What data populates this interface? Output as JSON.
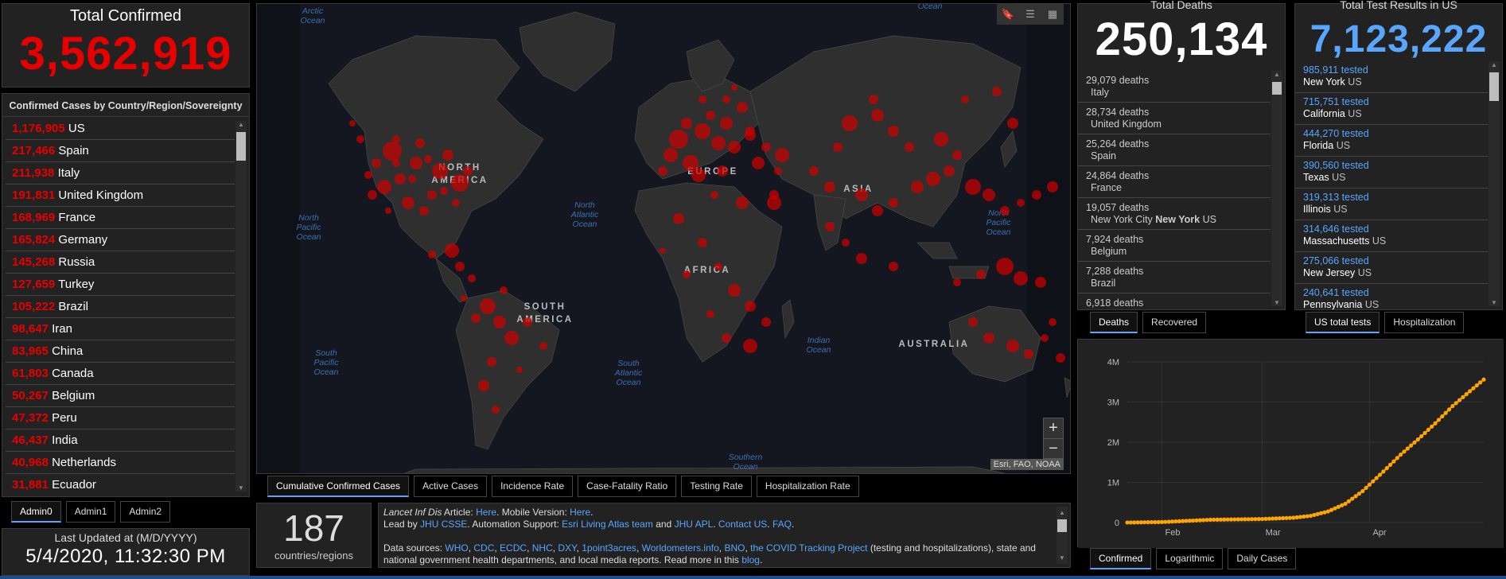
{
  "total_confirmed": {
    "title": "Total Confirmed",
    "value": "3,562,919"
  },
  "country_list": {
    "header": "Confirmed Cases by Country/Region/Sovereignty",
    "rows": [
      {
        "value": "1,176,905",
        "name": "US"
      },
      {
        "value": "217,466",
        "name": "Spain"
      },
      {
        "value": "211,938",
        "name": "Italy"
      },
      {
        "value": "191,831",
        "name": "United Kingdom"
      },
      {
        "value": "168,969",
        "name": "France"
      },
      {
        "value": "165,824",
        "name": "Germany"
      },
      {
        "value": "145,268",
        "name": "Russia"
      },
      {
        "value": "127,659",
        "name": "Turkey"
      },
      {
        "value": "105,222",
        "name": "Brazil"
      },
      {
        "value": "98,647",
        "name": "Iran"
      },
      {
        "value": "83,965",
        "name": "China"
      },
      {
        "value": "61,803",
        "name": "Canada"
      },
      {
        "value": "50,267",
        "name": "Belgium"
      },
      {
        "value": "47,372",
        "name": "Peru"
      },
      {
        "value": "46,437",
        "name": "India"
      },
      {
        "value": "40,968",
        "name": "Netherlands"
      },
      {
        "value": "31,881",
        "name": "Ecuador"
      }
    ]
  },
  "admin_tabs": [
    "Admin0",
    "Admin1",
    "Admin2"
  ],
  "last_updated": {
    "title": "Last Updated at (M/D/YYYY)",
    "value": "5/4/2020, 11:32:30 PM"
  },
  "map": {
    "oceans": [
      "Arctic Ocean",
      "North Pacific Ocean",
      "North Atlantic Ocean",
      "South Pacific Ocean",
      "South Atlantic Ocean",
      "Indian Ocean",
      "Southern Ocean",
      "North Pacific Ocean",
      "Ocean"
    ],
    "continents": [
      "NORTH AMERICA",
      "EUROPE",
      "ASIA",
      "AFRICA",
      "SOUTH AMERICA",
      "AUSTRALIA"
    ],
    "attribution": "Esri, FAO, NOAA",
    "zoom_in": "+",
    "zoom_out": "−",
    "tool_icons": [
      "bookmark-icon",
      "legend-icon",
      "qr-code-icon"
    ],
    "marker_color": "#cc0000"
  },
  "map_tabs": [
    "Cumulative Confirmed Cases",
    "Active Cases",
    "Incidence Rate",
    "Case-Fatality Ratio",
    "Testing Rate",
    "Hospitalization Rate"
  ],
  "countries_count": {
    "value": "187",
    "label": "countries/regions"
  },
  "info": {
    "line1_pre": "Lancet Inf Dis",
    "line1_article": " Article: ",
    "here1": "Here",
    "mobile": ". Mobile Version: ",
    "here2": "Here",
    "dot": ".",
    "led_by": "Lead by ",
    "jhu_csse": "JHU CSSE",
    "automation": ". Automation Support: ",
    "esri_team": "Esri Living Atlas team",
    "and": " and ",
    "jhu_apl": "JHU APL",
    "dot2": ". ",
    "contact": "Contact US",
    "dot3": ". ",
    "faq": "FAQ",
    "dot4": ".",
    "sources_label": "Data sources: ",
    "sources": [
      "WHO",
      "CDC",
      "ECDC",
      "NHC",
      "DXY",
      "1point3acres",
      "Worldometers.info",
      "BNO",
      "the COVID Tracking Project"
    ],
    "sources_suffix": " (testing and hospitalizations), state and national government health departments, and local media reports.  Read more in this ",
    "blog": "blog",
    "end": "."
  },
  "deaths": {
    "title": "Total Deaths",
    "value": "250,134",
    "rows": [
      {
        "count": "29,079 deaths",
        "place": "Italy",
        "bold": ""
      },
      {
        "count": "28,734 deaths",
        "place": "United Kingdom",
        "bold": ""
      },
      {
        "count": "25,264 deaths",
        "place": "Spain",
        "bold": ""
      },
      {
        "count": "24,864 deaths",
        "place": "France",
        "bold": ""
      },
      {
        "count": "19,057 deaths",
        "place": "New York City ",
        "bold": "New York",
        "suffix": " US"
      },
      {
        "count": "7,924 deaths",
        "place": "Belgium",
        "bold": ""
      },
      {
        "count": "7,288 deaths",
        "place": "Brazil",
        "bold": ""
      },
      {
        "count": "6,918 deaths",
        "place": "Germany",
        "bold": ""
      }
    ],
    "tabs": [
      "Deaths",
      "Recovered"
    ]
  },
  "tests": {
    "title": "Total Test Results in US",
    "value": "7,123,222",
    "rows": [
      {
        "count": "985,911 tested",
        "state": "New York",
        "country": " US"
      },
      {
        "count": "715,751 tested",
        "state": "California",
        "country": " US"
      },
      {
        "count": "444,270 tested",
        "state": "Florida",
        "country": " US"
      },
      {
        "count": "390,560 tested",
        "state": "Texas",
        "country": " US"
      },
      {
        "count": "319,313 tested",
        "state": "Illinois",
        "country": " US"
      },
      {
        "count": "314,646 tested",
        "state": "Massachusetts",
        "country": " US"
      },
      {
        "count": "275,066 tested",
        "state": "New Jersey",
        "country": " US"
      },
      {
        "count": "240,641 tested",
        "state": "Pennsylvania",
        "country": " US"
      }
    ],
    "tabs": [
      "US total tests",
      "Hospitalization"
    ]
  },
  "chart_tabs": [
    "Confirmed",
    "Logarithmic",
    "Daily Cases"
  ],
  "chart_data": {
    "type": "line",
    "y_tick_labels": [
      "0",
      "1M",
      "2M",
      "3M",
      "4M"
    ],
    "x_tick_labels": [
      "Feb",
      "Mar",
      "Apr"
    ],
    "ylim": [
      0,
      4000000
    ],
    "x": [
      "2020-01-22",
      "2020-02-01",
      "2020-02-15",
      "2020-03-01",
      "2020-03-10",
      "2020-03-15",
      "2020-03-20",
      "2020-03-25",
      "2020-03-30",
      "2020-04-05",
      "2020-04-10",
      "2020-04-15",
      "2020-04-20",
      "2020-04-25",
      "2020-04-30",
      "2020-05-04"
    ],
    "values": [
      555,
      12000,
      69000,
      88000,
      119000,
      167000,
      276000,
      467000,
      782000,
      1270000,
      1690000,
      2070000,
      2470000,
      2900000,
      3270000,
      3560000
    ],
    "line_color": "#ffa500"
  }
}
